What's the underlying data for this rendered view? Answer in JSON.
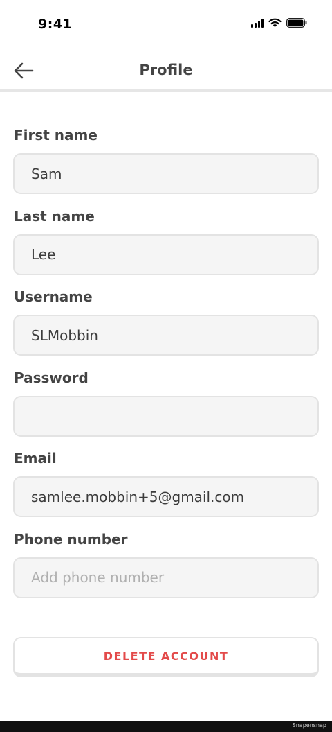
{
  "status_bar": {
    "time": "9:41"
  },
  "header": {
    "title": "Profile"
  },
  "form": {
    "fields": [
      {
        "label": "First name",
        "value": "Sam",
        "placeholder": ""
      },
      {
        "label": "Last name",
        "value": "Lee",
        "placeholder": ""
      },
      {
        "label": "Username",
        "value": "SLMobbin",
        "placeholder": ""
      },
      {
        "label": "Password",
        "value": "",
        "placeholder": ""
      },
      {
        "label": "Email",
        "value": "samlee.mobbin+5@gmail.com",
        "placeholder": ""
      },
      {
        "label": "Phone number",
        "value": "",
        "placeholder": "Add phone number"
      }
    ]
  },
  "actions": {
    "delete_label": "DELETE ACCOUNT"
  },
  "footer": {
    "watermark": "Snapensnap"
  },
  "colors": {
    "danger": "#e34a4a",
    "input_bg": "#f5f5f5",
    "border": "#e3e3e3",
    "text": "#444444"
  },
  "icons": {
    "back": "arrow-left-icon",
    "signal": "cellular-signal-icon",
    "wifi": "wifi-icon",
    "battery": "battery-icon"
  }
}
